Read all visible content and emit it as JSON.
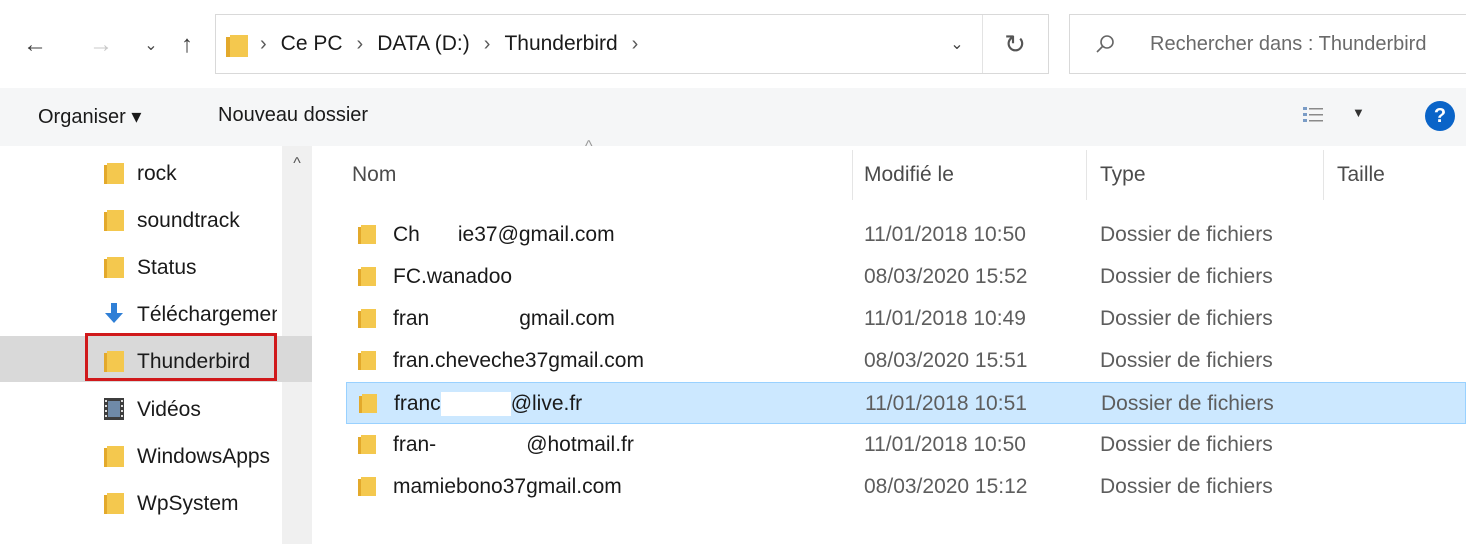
{
  "nav": {
    "back_icon": "arrow-left-icon",
    "forward_icon": "arrow-right-icon",
    "recent_icon": "chevron-down-icon",
    "up_icon": "arrow-up-icon"
  },
  "address": {
    "crumbs": [
      "Ce PC",
      "DATA (D:)",
      "Thunderbird"
    ],
    "refresh_icon": "refresh-icon"
  },
  "search": {
    "placeholder": "Rechercher dans : Thunderbird"
  },
  "toolbar": {
    "organize_label": "Organiser ▾",
    "new_folder_label": "Nouveau dossier",
    "help_label": "?"
  },
  "sidebar": {
    "items": [
      {
        "label": "rock",
        "icon": "folder-icon"
      },
      {
        "label": "soundtrack",
        "icon": "folder-icon"
      },
      {
        "label": "Status",
        "icon": "folder-icon"
      },
      {
        "label": "Téléchargements",
        "icon": "download-icon"
      },
      {
        "label": "Thunderbird",
        "icon": "folder-icon",
        "selected": true
      },
      {
        "label": "Vidéos",
        "icon": "video-icon"
      },
      {
        "label": "WindowsApps",
        "icon": "folder-icon"
      },
      {
        "label": "WpSystem",
        "icon": "folder-icon"
      }
    ]
  },
  "columns": {
    "name": "Nom",
    "modified": "Modifié le",
    "type": "Type",
    "size": "Taille"
  },
  "files": [
    {
      "name_a": "Ch",
      "name_b": "ie37@gmail.com",
      "modified": "11/01/2018 10:50",
      "type": "Dossier de fichiers"
    },
    {
      "name_a": "FC.wanadoo",
      "name_b": "",
      "modified": "08/03/2020 15:52",
      "type": "Dossier de fichiers"
    },
    {
      "name_a": "fran",
      "name_b": "gmail.com",
      "modified": "11/01/2018 10:49",
      "type": "Dossier de fichiers"
    },
    {
      "name_a": "fran.cheveche37gmail.com",
      "name_b": "",
      "modified": "08/03/2020 15:51",
      "type": "Dossier de fichiers"
    },
    {
      "name_a": "franc",
      "name_b": "@live.fr",
      "modified": "11/01/2018 10:51",
      "type": "Dossier de fichiers",
      "selected": true
    },
    {
      "name_a": "fran-",
      "name_b": "@hotmail.fr",
      "modified": "11/01/2018 10:50",
      "type": "Dossier de fichiers"
    },
    {
      "name_a": "mamiebono37gmail.com",
      "name_b": "",
      "modified": "08/03/2020 15:12",
      "type": "Dossier de fichiers"
    }
  ],
  "colors": {
    "selection": "#cce8ff",
    "highlight_box": "#d0191b",
    "folder": "#f4c84e"
  }
}
